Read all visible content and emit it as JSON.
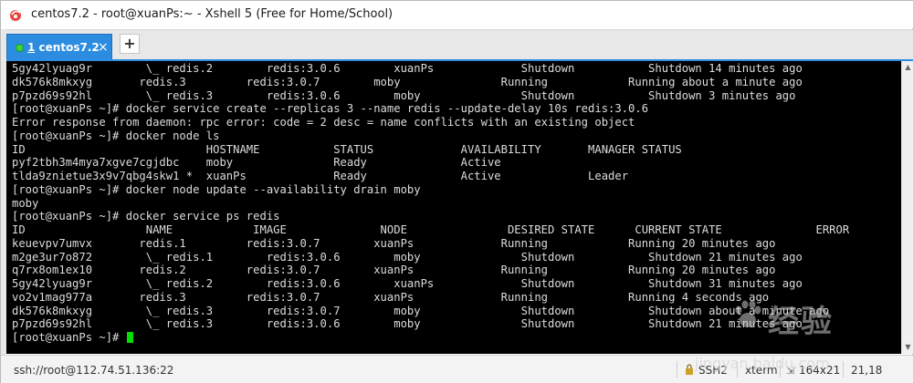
{
  "window": {
    "title": "centos7.2 - root@xuanPs:~ - Xshell 5 (Free for Home/School)"
  },
  "tabs": [
    {
      "number": "1",
      "label": "centos7.2",
      "close": "×"
    }
  ],
  "add_tab_label": "+",
  "terminal": {
    "lines": [
      "5gy42lyuag9r        \\_ redis.2        redis:3.0.6        xuanPs             Shutdown           Shutdown 14 minutes ago",
      "dk576k8mkxyg       redis.3         redis:3.0.7        moby               Running            Running about a minute ago",
      "p7pzd69s92hl        \\_ redis.3        redis:3.0.6        moby               Shutdown           Shutdown 3 minutes ago",
      "[root@xuanPs ~]# docker service create --replicas 3 --name redis --update-delay 10s redis:3.0.6",
      "Error response from daemon: rpc error: code = 2 desc = name conflicts with an existing object",
      "[root@xuanPs ~]# docker node ls",
      "ID                           HOSTNAME           STATUS             AVAILABILITY       MANAGER STATUS",
      "pyf2tbh3m4mya7xgve7cgjdbc    moby               Ready              Active",
      "tlda9znietue3x9v7qbg4skw1 *  xuanPs             Ready              Active             Leader",
      "[root@xuanPs ~]# docker node update --availability drain moby",
      "moby",
      "[root@xuanPs ~]# docker service ps redis",
      "ID                  NAME            IMAGE              NODE               DESIRED STATE      CURRENT STATE              ERROR",
      "keuevpv7umvx       redis.1         redis:3.0.7        xuanPs             Running            Running 20 minutes ago",
      "m2ge3ur7o872        \\_ redis.1        redis:3.0.6        moby               Shutdown           Shutdown 21 minutes ago",
      "q7rx8om1ex10       redis.2         redis:3.0.7        xuanPs             Running            Running 20 minutes ago",
      "5gy42lyuag9r        \\_ redis.2        redis:3.0.6        xuanPs             Shutdown           Shutdown 31 minutes ago",
      "vo2v1mag977a       redis.3         redis:3.0.7        xuanPs             Running            Running 4 seconds ago",
      "dk576k8mkxyg        \\_ redis.3        redis:3.0.7        moby               Shutdown           Shutdown about a minute ago",
      "p7pzd69s92hl        \\_ redis.3        redis:3.0.6        moby               Shutdown           Shutdown 21 minutes ago"
    ],
    "prompt": "[root@xuanPs ~]# "
  },
  "statusbar": {
    "connection": "ssh://root@112.74.51.136:22",
    "protocol": "SSH2",
    "terminal_type": "xterm",
    "size": "164x21",
    "cursor_pos": "21,18"
  },
  "watermark": {
    "brand": "经验",
    "url": "jingyan.baidu.com"
  },
  "colors": {
    "tab_active": "#2b8ce0",
    "terminal_bg": "#000000",
    "terminal_fg": "#dcdcdc",
    "cursor": "#00e000"
  }
}
